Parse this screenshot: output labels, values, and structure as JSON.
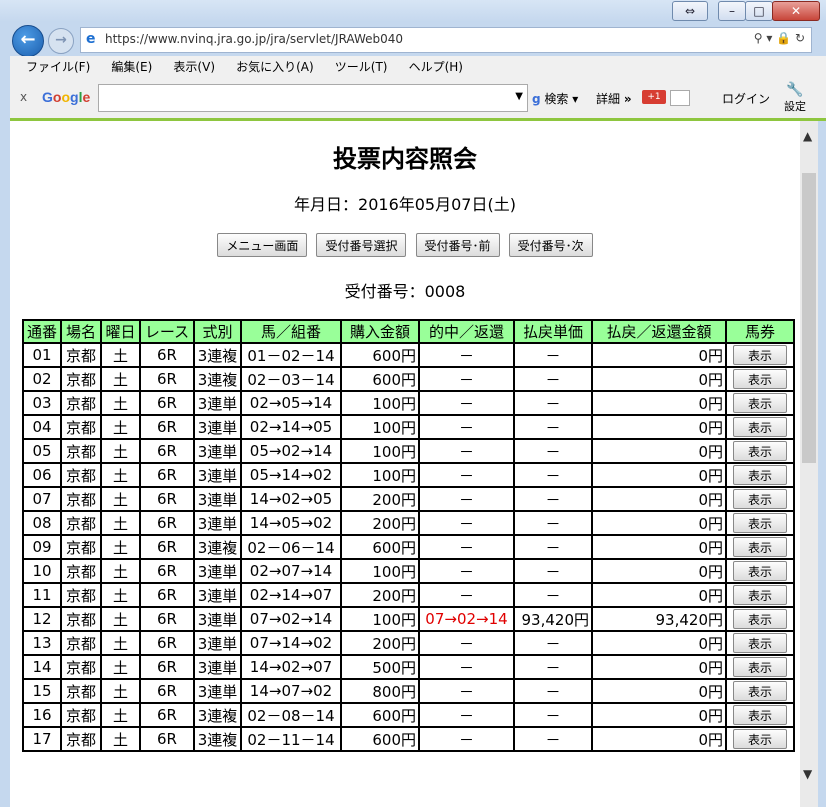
{
  "browser": {
    "url": "https://www.nvinq.jra.go.jp/jra/servlet/JRAWeb040",
    "menu": [
      "ファイル(F)",
      "編集(E)",
      "表示(V)",
      "お気に入り(A)",
      "ツール(T)",
      "ヘルプ(H)"
    ],
    "google": {
      "close": "x",
      "logo": "Google",
      "search_label": "検索",
      "detail_label": "詳細",
      "more_glyph": "»",
      "gplus_label": "+1",
      "login_label": "ログイン",
      "settings_label": "設定"
    },
    "window_buttons": {
      "restore": "⇔",
      "minimize": "–",
      "maximize": "□",
      "close": "✕"
    }
  },
  "page": {
    "title": "投票内容照会",
    "date": "年月日：2016年05月07日(土)",
    "buttons": [
      "メニュー画面",
      "受付番号選択",
      "受付番号･前",
      "受付番号･次"
    ],
    "receipt": "受付番号：0008"
  },
  "table": {
    "headers": [
      "通番",
      "場名",
      "曜日",
      "レース",
      "式別",
      "馬／組番",
      "購入金額",
      "的中／返還",
      "払戻単価",
      "払戻／返還金額",
      "馬券"
    ],
    "show_label": "表示",
    "rows": [
      [
        "01",
        "京都",
        "土",
        "6R",
        "3連複",
        "01－02－14",
        "600円",
        "－",
        "－",
        "0円"
      ],
      [
        "02",
        "京都",
        "土",
        "6R",
        "3連複",
        "02－03－14",
        "600円",
        "－",
        "－",
        "0円"
      ],
      [
        "03",
        "京都",
        "土",
        "6R",
        "3連単",
        "02→05→14",
        "100円",
        "－",
        "－",
        "0円"
      ],
      [
        "04",
        "京都",
        "土",
        "6R",
        "3連単",
        "02→14→05",
        "100円",
        "－",
        "－",
        "0円"
      ],
      [
        "05",
        "京都",
        "土",
        "6R",
        "3連単",
        "05→02→14",
        "100円",
        "－",
        "－",
        "0円"
      ],
      [
        "06",
        "京都",
        "土",
        "6R",
        "3連単",
        "05→14→02",
        "100円",
        "－",
        "－",
        "0円"
      ],
      [
        "07",
        "京都",
        "土",
        "6R",
        "3連単",
        "14→02→05",
        "200円",
        "－",
        "－",
        "0円"
      ],
      [
        "08",
        "京都",
        "土",
        "6R",
        "3連単",
        "14→05→02",
        "200円",
        "－",
        "－",
        "0円"
      ],
      [
        "09",
        "京都",
        "土",
        "6R",
        "3連複",
        "02－06－14",
        "600円",
        "－",
        "－",
        "0円"
      ],
      [
        "10",
        "京都",
        "土",
        "6R",
        "3連単",
        "02→07→14",
        "100円",
        "－",
        "－",
        "0円"
      ],
      [
        "11",
        "京都",
        "土",
        "6R",
        "3連単",
        "02→14→07",
        "200円",
        "－",
        "－",
        "0円"
      ],
      [
        "12",
        "京都",
        "土",
        "6R",
        "3連単",
        "07→02→14",
        "100円",
        "07→02→14",
        "93,420円",
        "93,420円"
      ],
      [
        "13",
        "京都",
        "土",
        "6R",
        "3連単",
        "07→14→02",
        "200円",
        "－",
        "－",
        "0円"
      ],
      [
        "14",
        "京都",
        "土",
        "6R",
        "3連単",
        "14→02→07",
        "500円",
        "－",
        "－",
        "0円"
      ],
      [
        "15",
        "京都",
        "土",
        "6R",
        "3連単",
        "14→07→02",
        "800円",
        "－",
        "－",
        "0円"
      ],
      [
        "16",
        "京都",
        "土",
        "6R",
        "3連複",
        "02－08－14",
        "600円",
        "－",
        "－",
        "0円"
      ],
      [
        "17",
        "京都",
        "土",
        "6R",
        "3連複",
        "02－11－14",
        "600円",
        "－",
        "－",
        "0円"
      ]
    ],
    "hit_color": "#e00000"
  }
}
